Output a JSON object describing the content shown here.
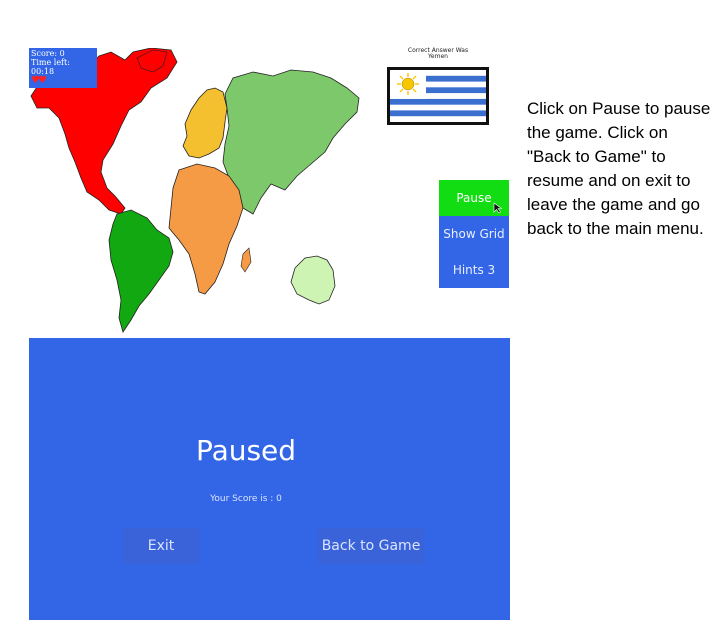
{
  "hud": {
    "score_text": "Score: 0",
    "time_text": "Time left: 00:18",
    "hearts": "♥♥"
  },
  "answer": {
    "caption_line1": "Correct Answer Was",
    "caption_line2": "Yemen",
    "flag_icon": "uruguay-flag"
  },
  "side_menu": {
    "pause_label": "Pause",
    "grid_label": "Show Grid",
    "hints_label": "Hints 3"
  },
  "help_text": "Click on Pause to pause the game. Click on \"Back to Game\" to resume and on exit to leave the game and go back to the main menu.",
  "pause_panel": {
    "title": "Paused",
    "score_text": "Your Score is : 0",
    "exit_label": "Exit",
    "back_label": "Back to Game"
  },
  "colors": {
    "panel_blue": "#3366e6",
    "active_green": "#12dd12",
    "north_america": "#ff0000",
    "south_america": "#12a812",
    "europe": "#f5c030",
    "asia": "#7cc86a",
    "africa": "#f59a45",
    "australia": "#cdf4b3"
  }
}
